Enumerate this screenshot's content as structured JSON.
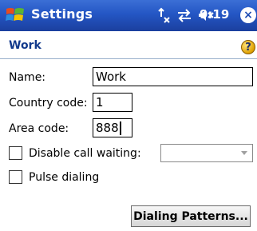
{
  "titlebar": {
    "app_title": "Settings",
    "clock": "9:19",
    "status_icons": [
      "signal-icon",
      "connectivity-icon",
      "volume-muted-icon"
    ],
    "close_label": "×"
  },
  "page": {
    "title": "Work",
    "help_label": "?"
  },
  "form": {
    "name_label": "Name:",
    "name_value": "Work",
    "country_label": "Country code:",
    "country_value": "1",
    "area_label": "Area code:",
    "area_value": "888",
    "disable_call_waiting_label": "Disable call waiting:",
    "disable_call_waiting_checked": false,
    "disable_call_waiting_selected": "",
    "pulse_dialing_label": "Pulse dialing",
    "pulse_dialing_checked": false
  },
  "actions": {
    "dialing_patterns_label": "Dialing Patterns..."
  },
  "colors": {
    "titlebar": "#2456c4",
    "page_title": "#123a8c"
  }
}
